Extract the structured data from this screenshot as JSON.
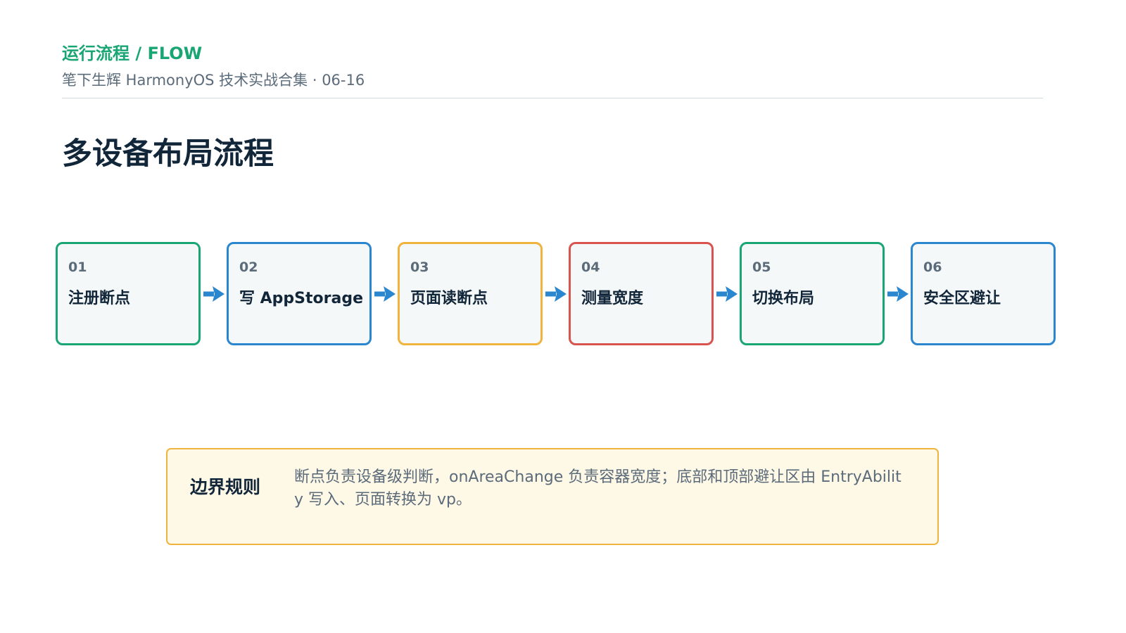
{
  "header": {
    "kicker": "运行流程 / FLOW",
    "subtitle": "笔下生辉 HarmonyOS 技术实战合集 · 06-16"
  },
  "title": "多设备布局流程",
  "colors": {
    "green": "#1aa574",
    "blue": "#2a86cf",
    "amber": "#f0b43e",
    "red": "#d9534f",
    "arrow": "#2a86cf"
  },
  "steps": [
    {
      "num": "01",
      "label": "注册断点",
      "color": "#1aa574"
    },
    {
      "num": "02",
      "label": "写 AppStorage",
      "color": "#2a86cf"
    },
    {
      "num": "03",
      "label": "页面读断点",
      "color": "#f0b43e"
    },
    {
      "num": "04",
      "label": "测量宽度",
      "color": "#d9534f"
    },
    {
      "num": "05",
      "label": "切换布局",
      "color": "#1aa574"
    },
    {
      "num": "06",
      "label": "安全区避让",
      "color": "#2a86cf"
    }
  ],
  "note": {
    "label": "边界规则",
    "text": "断点负责设备级判断，onAreaChange 负责容器宽度；底部和顶部避让区由 EntryAbility 写入、页面转换为 vp。"
  }
}
